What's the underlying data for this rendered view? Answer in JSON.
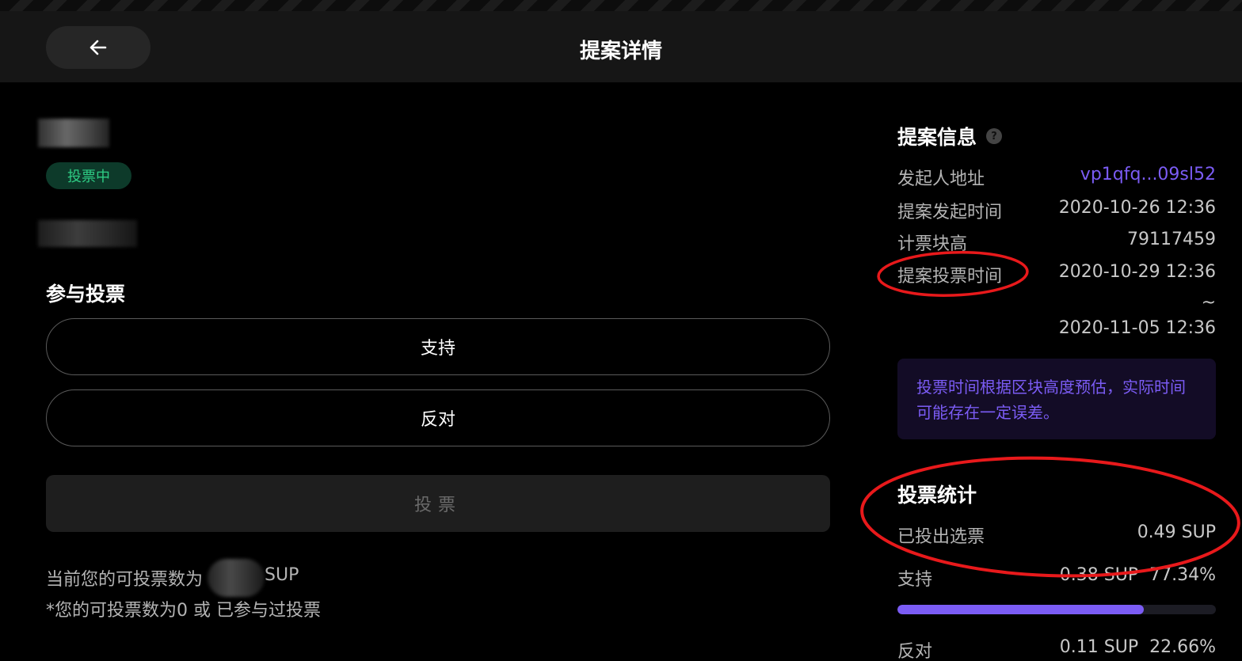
{
  "header": {
    "title": "提案详情",
    "back_icon": "arrow-left-icon"
  },
  "proposal": {
    "status": "投票中"
  },
  "vote": {
    "section_title": "参与投票",
    "support_label": "支持",
    "oppose_label": "反对",
    "submit_label": "投票",
    "available_prefix": "当前您的可投票数为",
    "available_unit": "SUP",
    "hint": "*您的可投票数为0 或 已参与过投票"
  },
  "info": {
    "title": "提案信息",
    "help_icon": "question-icon",
    "rows": [
      {
        "label": "发起人地址",
        "value": "vp1qfq...09sl52"
      },
      {
        "label": "提案发起时间",
        "value": "2020-10-26 12:36"
      },
      {
        "label": "计票块高",
        "value": "79117459"
      },
      {
        "label": "提案投票时间",
        "value": "2020-10-29 12:36"
      }
    ],
    "tilde": "~",
    "end_time": "2020-11-05 12:36",
    "notice": "投票时间根据区块高度预估，实际时间可能存在一定误差。"
  },
  "stats": {
    "title": "投票统计",
    "cast_label": "已投出选票",
    "cast_value": "0.49 SUP",
    "support_label": "支持",
    "support_amount": "0.38 SUP",
    "support_percent": "77.34%",
    "support_ratio": 0.7734,
    "oppose_label": "反对",
    "oppose_amount": "0.11 SUP",
    "oppose_percent": "22.66%"
  },
  "colors": {
    "accent": "#7b5cf5",
    "status_green": "#2ecc84",
    "annotation": "#e8191b"
  }
}
